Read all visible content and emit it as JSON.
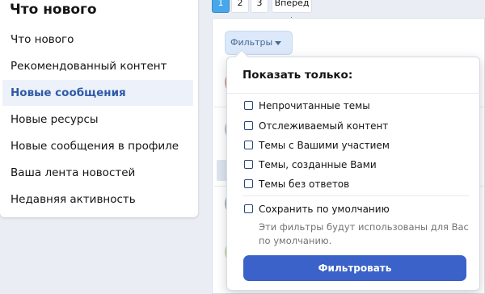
{
  "sidebar": {
    "title": "Что нового",
    "items": [
      {
        "label": "Что нового"
      },
      {
        "label": "Рекомендованный контент"
      },
      {
        "label": "Новые сообщения"
      },
      {
        "label": "Новые ресурсы"
      },
      {
        "label": "Новые сообщения в профиле"
      },
      {
        "label": "Ваша лента новостей"
      },
      {
        "label": "Недавняя активность"
      }
    ],
    "active_index": 2
  },
  "pagination": {
    "pages": [
      "1",
      "2",
      "3"
    ],
    "current": "1",
    "next_label": "Вперед"
  },
  "filter_toggle": {
    "label": "Фильтры"
  },
  "filter_menu": {
    "heading": "Показать только:",
    "options": [
      {
        "label": "Непрочитанные темы",
        "checked": false
      },
      {
        "label": "Отслеживаемый контент",
        "checked": false
      },
      {
        "label": "Темы с Вашими участием",
        "checked": false
      },
      {
        "label": "Темы, созданные Вами",
        "checked": false
      },
      {
        "label": "Темы без ответов",
        "checked": false
      }
    ],
    "save_default": {
      "label": "Сохранить по умолчанию",
      "checked": false
    },
    "save_hint": "Эти фильтры будут использованы для Вас по умолчанию.",
    "submit_label": "Фильтровать"
  },
  "colors": {
    "accent": "#3a62c8",
    "active_text": "#2f5aa8",
    "page_bg": "#eaeef4"
  }
}
